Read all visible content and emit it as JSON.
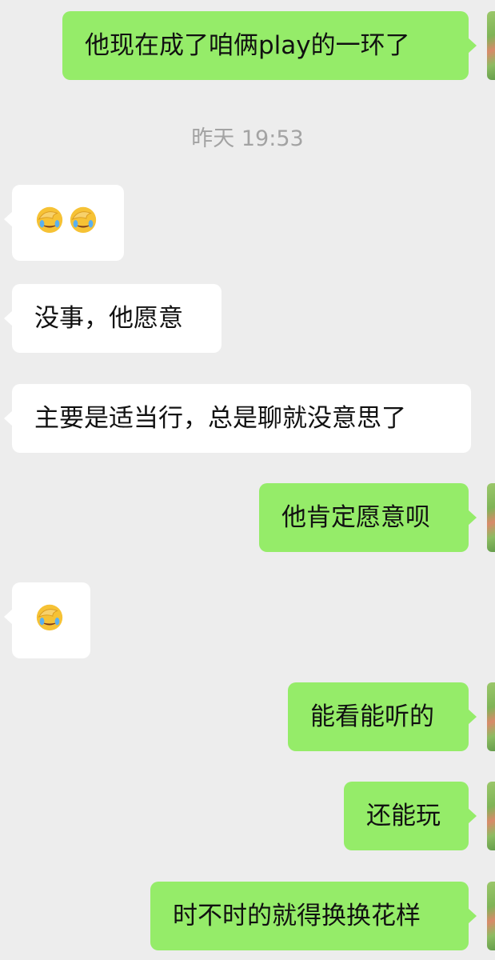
{
  "messages": [
    {
      "side": "out",
      "text": "他现在成了咱俩play的一环了"
    },
    {
      "side": "in",
      "emoji_count": 2,
      "emoji": "face-palm-crying-emoji"
    },
    {
      "side": "in",
      "text": "没事，他愿意"
    },
    {
      "side": "in",
      "text": "主要是适当行，总是聊就没意思了"
    },
    {
      "side": "out",
      "text": "他肯定愿意呗"
    },
    {
      "side": "in",
      "emoji_count": 1,
      "emoji": "face-palm-crying-emoji"
    },
    {
      "side": "out",
      "text": "能看能听的"
    },
    {
      "side": "out",
      "text": "还能玩"
    },
    {
      "side": "out",
      "text": "时不时的就得换换花样"
    }
  ],
  "timestamp": "昨天 19:53",
  "colors": {
    "background": "#ededed",
    "outgoing_bubble": "#95ec69",
    "incoming_bubble": "#ffffff",
    "timestamp_text": "#a3a3a3"
  }
}
